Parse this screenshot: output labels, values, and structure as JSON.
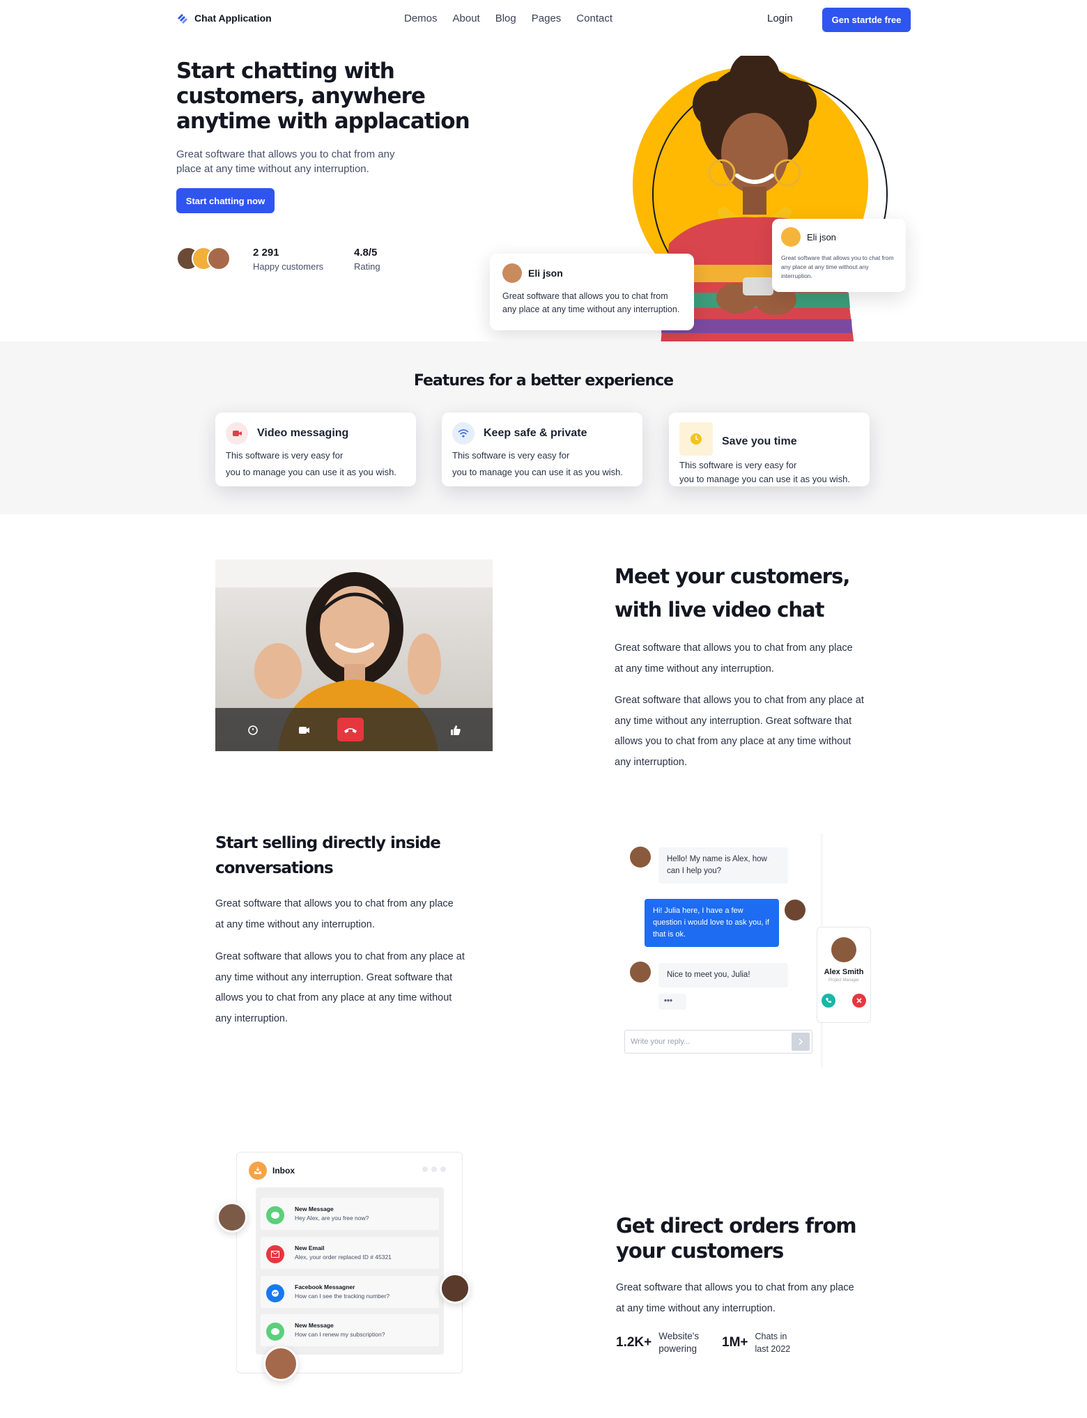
{
  "nav": {
    "brand": "Chat Application",
    "links": [
      "Demos",
      "About",
      "Blog",
      "Pages",
      "Contact"
    ],
    "login": "Login",
    "cta": "Gen startde free"
  },
  "hero": {
    "title": "Start chatting with customers, anywhere anytime with applacation",
    "subtitle": "Great software that allows you to chat from any place at any time without any interruption.",
    "button": "Start chatting now",
    "stats": [
      {
        "value": "2 291",
        "label": "Happy customers"
      },
      {
        "value": "4.8/5",
        "label": "Rating"
      }
    ],
    "card_large": {
      "name": "Eli json",
      "text": "Great software that allows you to chat from any place at any time without any interruption."
    },
    "card_small": {
      "name": "Eli json",
      "text": "Great software that allows you to chat from any place at any time without any interruption."
    }
  },
  "features": {
    "title": "Features for a better experience",
    "items": [
      {
        "title": "Video messaging",
        "icon": "video-icon",
        "line1": "This software is very easy for",
        "line2": "you to manage you can use it as you wish."
      },
      {
        "title": "Keep safe & private",
        "icon": "wifi-icon",
        "line1": "This software is very easy for",
        "line2": "you to manage you can use it as you wish."
      },
      {
        "title": "Save you time",
        "icon": "clock-icon",
        "line1": "This software is very easy for",
        "line2": "you to manage you can use it as you wish."
      }
    ]
  },
  "video_section": {
    "title": "Meet your customers, with live video chat",
    "p1": "Great software that allows you to chat from any place at any time without any interruption.",
    "p2": "Great software that allows you to chat from any place at any time without any interruption. Great software that allows you to chat from any place at any time without any interruption."
  },
  "selling_section": {
    "title": "Start selling directly inside conversations",
    "p1": "Great software that allows you to chat from any place at any time without any interruption.",
    "p2": "Great software that allows you to chat from any place at any time without any interruption. Great software that allows you to chat from any place at any time without any interruption.",
    "chat": {
      "msg1": "Hello! My name is Alex, how can I help you?",
      "msg2": "Hi! Julia here, I have a few question i would love to ask you, if that is ok.",
      "msg3": "Nice to meet you, Julia!",
      "typing": "•••",
      "reply_placeholder": "Write your reply...",
      "profile_name": "Alex Smith",
      "profile_role": "Project Manager"
    }
  },
  "orders_section": {
    "title": "Get direct orders from your customers",
    "p1": "Great software that allows you to chat from any place at any time without any interruption.",
    "metrics": [
      {
        "value": "1.2K+",
        "label": "Website's powering"
      },
      {
        "value": "1M+",
        "label": "Chats in last 2022"
      }
    ],
    "inbox": {
      "title": "Inbox",
      "items": [
        {
          "title": "New Message",
          "text": "Hey Alex, are you free now?"
        },
        {
          "title": "New Email",
          "text": "Alex,  your order replaced ID # 45321"
        },
        {
          "title": "Facebook Messagner",
          "text": "How can I see the tracking number?"
        },
        {
          "title": "New Message",
          "text": "How can I renew my subscription?"
        }
      ]
    }
  },
  "colors": {
    "primary": "#2f55f0",
    "accent_yellow": "#ffb902",
    "danger": "#e6373f",
    "success": "#14b8a6"
  }
}
